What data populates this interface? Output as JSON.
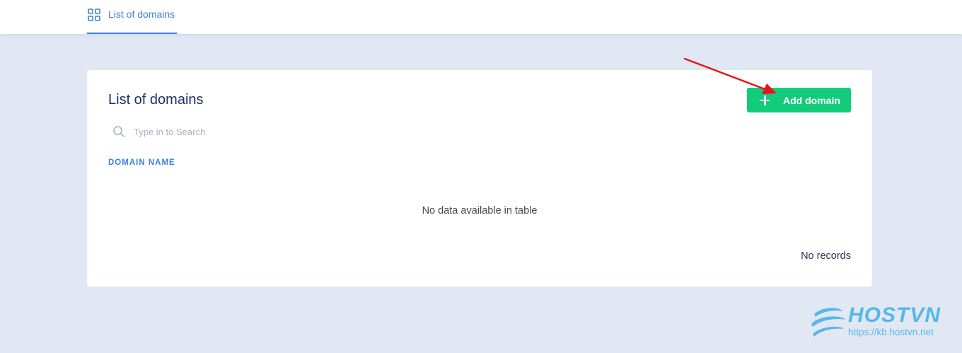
{
  "header": {
    "tab_label": "List of domains"
  },
  "card": {
    "title": "List of domains",
    "add_button_label": "Add domain",
    "search_placeholder": "Type in to Search",
    "table": {
      "columns": [
        "DOMAIN NAME"
      ],
      "rows": [],
      "empty_message": "No data available in table"
    },
    "records_text": "No records"
  },
  "watermark": {
    "brand": "HOSTVN",
    "url": "https://kb.hostvn.net"
  },
  "colors": {
    "page_background": "#e1e8f4",
    "accent": "#3d7fe0",
    "add_button": "#12cc7b",
    "title": "#1f2f66",
    "annotation_arrow": "#e8141c",
    "watermark": "#56b8ea"
  },
  "icons": {
    "tab": "dashboard-grid-icon",
    "search": "search-icon",
    "add": "plus-icon"
  }
}
